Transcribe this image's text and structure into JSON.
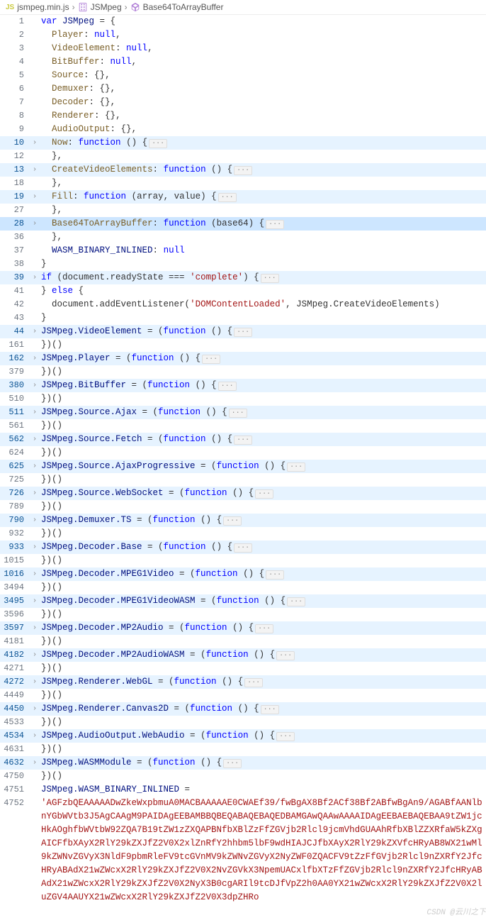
{
  "breadcrumb": {
    "file": "jsmpeg.min.js",
    "sym1": "JSMpeg",
    "sym2": "Base64ToArrayBuffer",
    "file_icon_color": "#cbcb41",
    "js_badge": "JS"
  },
  "keywords": {
    "var": "var",
    "null": "null",
    "function": "function",
    "if": "if",
    "else": "else"
  },
  "code": {
    "l1": {
      "ln": "1",
      "t": [
        "var ",
        "JSMpeg",
        " = {"
      ]
    },
    "l2": {
      "ln": "2",
      "prop": "Player",
      "val": "null"
    },
    "l3": {
      "ln": "3",
      "prop": "VideoElement",
      "val": "null"
    },
    "l4": {
      "ln": "4",
      "prop": "BitBuffer",
      "val": "null"
    },
    "l5": {
      "ln": "5",
      "prop": "Source",
      "val": "{}"
    },
    "l6": {
      "ln": "6",
      "prop": "Demuxer",
      "val": "{}"
    },
    "l7": {
      "ln": "7",
      "prop": "Decoder",
      "val": "{}"
    },
    "l8": {
      "ln": "8",
      "prop": "Renderer",
      "val": "{}"
    },
    "l9": {
      "ln": "9",
      "prop": "AudioOutput",
      "val": "{}"
    },
    "l10": {
      "ln": "10",
      "prop": "Now",
      "args": "()"
    },
    "l12": {
      "ln": "12"
    },
    "l13": {
      "ln": "13",
      "prop": "CreateVideoElements",
      "args": "()"
    },
    "l18": {
      "ln": "18"
    },
    "l19": {
      "ln": "19",
      "prop": "Fill",
      "args": "(array, value)"
    },
    "l27": {
      "ln": "27"
    },
    "l28": {
      "ln": "28",
      "prop": "Base64ToArrayBuffer",
      "args": "(base64)"
    },
    "l36": {
      "ln": "36"
    },
    "l37": {
      "ln": "37",
      "prop": "WASM_BINARY_INLINED",
      "val": "null"
    },
    "l38": {
      "ln": "38"
    },
    "l39": {
      "ln": "39",
      "cond": "document.readyState === ",
      "str": "'complete'"
    },
    "l41": {
      "ln": "41"
    },
    "l42": {
      "ln": "42",
      "call": "document.addEventListener(",
      "arg1": "'DOMContentLoaded'",
      "arg2": ", JSMpeg.CreateVideoElements)"
    },
    "l43": {
      "ln": "43"
    },
    "l44": {
      "ln": "44",
      "lhs": "JSMpeg.VideoElement"
    },
    "l161": {
      "ln": "161"
    },
    "l162": {
      "ln": "162",
      "lhs": "JSMpeg.Player"
    },
    "l379": {
      "ln": "379"
    },
    "l380": {
      "ln": "380",
      "lhs": "JSMpeg.BitBuffer"
    },
    "l510": {
      "ln": "510"
    },
    "l511": {
      "ln": "511",
      "lhs": "JSMpeg.Source.Ajax"
    },
    "l561": {
      "ln": "561"
    },
    "l562": {
      "ln": "562",
      "lhs": "JSMpeg.Source.Fetch"
    },
    "l624": {
      "ln": "624"
    },
    "l625": {
      "ln": "625",
      "lhs": "JSMpeg.Source.AjaxProgressive"
    },
    "l725": {
      "ln": "725"
    },
    "l726": {
      "ln": "726",
      "lhs": "JSMpeg.Source.WebSocket"
    },
    "l789": {
      "ln": "789"
    },
    "l790": {
      "ln": "790",
      "lhs": "JSMpeg.Demuxer.TS"
    },
    "l932": {
      "ln": "932"
    },
    "l933": {
      "ln": "933",
      "lhs": "JSMpeg.Decoder.Base"
    },
    "l1015": {
      "ln": "1015"
    },
    "l1016": {
      "ln": "1016",
      "lhs": "JSMpeg.Decoder.MPEG1Video"
    },
    "l3494": {
      "ln": "3494"
    },
    "l3495": {
      "ln": "3495",
      "lhs": "JSMpeg.Decoder.MPEG1VideoWASM"
    },
    "l3596": {
      "ln": "3596"
    },
    "l3597": {
      "ln": "3597",
      "lhs": "JSMpeg.Decoder.MP2Audio"
    },
    "l4181": {
      "ln": "4181"
    },
    "l4182": {
      "ln": "4182",
      "lhs": "JSMpeg.Decoder.MP2AudioWASM"
    },
    "l4271": {
      "ln": "4271"
    },
    "l4272": {
      "ln": "4272",
      "lhs": "JSMpeg.Renderer.WebGL"
    },
    "l4449": {
      "ln": "4449"
    },
    "l4450": {
      "ln": "4450",
      "lhs": "JSMpeg.Renderer.Canvas2D"
    },
    "l4533": {
      "ln": "4533"
    },
    "l4534": {
      "ln": "4534",
      "lhs": "JSMpeg.AudioOutput.WebAudio"
    },
    "l4631": {
      "ln": "4631"
    },
    "l4632": {
      "ln": "4632",
      "lhs": "JSMpeg.WASMModule"
    },
    "l4750": {
      "ln": "4750"
    },
    "l4751": {
      "ln": "4751",
      "lhs": "JSMpeg.WASM_BINARY_INLINED",
      "op": " ="
    },
    "l4752": {
      "ln": "4752",
      "str": "'AGFzbQEAAAAADwZkeWxpbmuA0MACBAAAAAE0CWAEf39/fwBgAX8Bf2ACf38Bf2ABfwBgAn9/AGABfAANlbnYGbWVtb3J5AgCAAgM9PAIDAgEEBAMBBQBEQABAQEBAQEDBAMGAwQAAwAAAAIDAgEEBAEBAQEBAA9tZW1jcHkAOghfbWVtbW92ZQA7B19tZW1zZXQAPBNfbXBlZzFfZGVjb2Rlcl9jcmVhdGUAAhRfbXBlZZXRfaW5kZXgAICFfbXAyX2RlY29kZXJfZ2V0X2xlZnRfY2hhbm5lbF9wdHIAJCJfbXAyX2RlY29kZXVfcHRyAB8WX21wMl9kZWNvZGVyX3NldF9pbmRleFV9tcGVnMV9kZWNvZGVyX2NyZWF0ZQACFV9tZzFfGVjb2Rlcl9nZXRfY2JfcHRyABAdX21wZWcxX2RlY29kZXJfZ2V0X2NvZGVkX3NpemUACxlfbXTzFfZGVjb2Rlcl9nZXRfY2JfcHRyABAdX21wZWcxX2RlY29kZXJfZ2V0X2NyX3B0cgARIl9tcDJfVpZ2h0AA0YX21wZWcxX2RlY29kZXJfZ2V0X2luZGV4AAUYX21wZWcxX2RlY29kZXJfZ2V0X3dpZHRo"
    }
  },
  "closebrace": "},",
  "iife_close": "})()",
  "fold_marker": "···",
  "watermark": "CSDN @云川之下"
}
